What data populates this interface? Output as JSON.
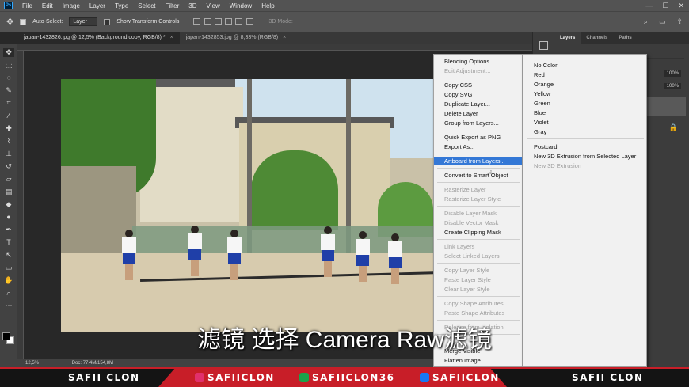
{
  "app": {
    "logo": "Ps"
  },
  "menubar": {
    "items": [
      "File",
      "Edit",
      "Image",
      "Layer",
      "Type",
      "Select",
      "Filter",
      "3D",
      "View",
      "Window",
      "Help"
    ]
  },
  "window_controls": {
    "minimize": "—",
    "maximize": "☐",
    "close": "✕"
  },
  "options": {
    "auto_select_label": "Auto-Select:",
    "auto_select_value": "Layer",
    "transform_label": "Show Transform Controls",
    "mode3d": "3D Mode:"
  },
  "tabs": [
    {
      "label": "japan-1432826.jpg @ 12,5% (Background copy, RGB/8) *",
      "close": "×"
    },
    {
      "label": "japan-1432853.jpg @ 8,33% (RGB/8)",
      "close": "×"
    }
  ],
  "panel": {
    "tabs": [
      "Layers",
      "Channels",
      "Paths"
    ],
    "opacity": "100%",
    "fill": "100%"
  },
  "context_menu": {
    "items": [
      {
        "label": "Blending Options...",
        "state": "enabled"
      },
      {
        "label": "Edit Adjustment...",
        "state": "disabled"
      },
      {
        "label": "Copy CSS",
        "state": "enabled"
      },
      {
        "label": "Copy SVG",
        "state": "enabled"
      },
      {
        "label": "Duplicate Layer...",
        "state": "enabled"
      },
      {
        "label": "Delete Layer",
        "state": "enabled"
      },
      {
        "label": "Group from Layers...",
        "state": "enabled"
      },
      {
        "label": "Quick Export as PNG",
        "state": "enabled"
      },
      {
        "label": "Export As...",
        "state": "enabled"
      },
      {
        "label": "Artboard from Layers...",
        "state": "highlighted"
      },
      {
        "label": "Convert to Smart Object",
        "state": "enabled"
      },
      {
        "label": "Rasterize Layer",
        "state": "disabled"
      },
      {
        "label": "Rasterize Layer Style",
        "state": "disabled"
      },
      {
        "label": "Disable Layer Mask",
        "state": "disabled"
      },
      {
        "label": "Disable Vector Mask",
        "state": "disabled"
      },
      {
        "label": "Create Clipping Mask",
        "state": "enabled"
      },
      {
        "label": "Link Layers",
        "state": "disabled"
      },
      {
        "label": "Select Linked Layers",
        "state": "disabled"
      },
      {
        "label": "Copy Layer Style",
        "state": "disabled"
      },
      {
        "label": "Paste Layer Style",
        "state": "disabled"
      },
      {
        "label": "Clear Layer Style",
        "state": "disabled"
      },
      {
        "label": "Copy Shape Attributes",
        "state": "disabled"
      },
      {
        "label": "Paste Shape Attributes",
        "state": "disabled"
      },
      {
        "label": "Release from Isolation",
        "state": "disabled"
      },
      {
        "label": "Merge Visible",
        "state": "enabled"
      },
      {
        "label": "Flatten Image",
        "state": "enabled"
      }
    ]
  },
  "context_menu_2": {
    "items": [
      {
        "label": "No Color",
        "state": "enabled"
      },
      {
        "label": "Red",
        "state": "enabled"
      },
      {
        "label": "Orange",
        "state": "enabled"
      },
      {
        "label": "Yellow",
        "state": "enabled"
      },
      {
        "label": "Green",
        "state": "enabled"
      },
      {
        "label": "Blue",
        "state": "enabled"
      },
      {
        "label": "Violet",
        "state": "enabled"
      },
      {
        "label": "Gray",
        "state": "enabled"
      },
      {
        "label": "Postcard",
        "state": "enabled"
      },
      {
        "label": "New 3D Extrusion from Selected Layer",
        "state": "enabled"
      },
      {
        "label": "New 3D Extrusion",
        "state": "disabled"
      }
    ]
  },
  "statusbar": {
    "zoom": "12,5%",
    "doc": "Doc: 77,4M/154,8M"
  },
  "subtitle": "滤镜  选择 Camera Raw滤镜",
  "banner": {
    "left": "SAFII CLON",
    "instagram": "SAFIICLON",
    "tiktok": "SAFIICLON36",
    "facebook": "SAFIICLON",
    "right": "SAFII CLON"
  },
  "colors": {
    "highlight": "#3478d6",
    "banner_red": "#c81e28",
    "menu_bg": "#f1f1f1"
  }
}
